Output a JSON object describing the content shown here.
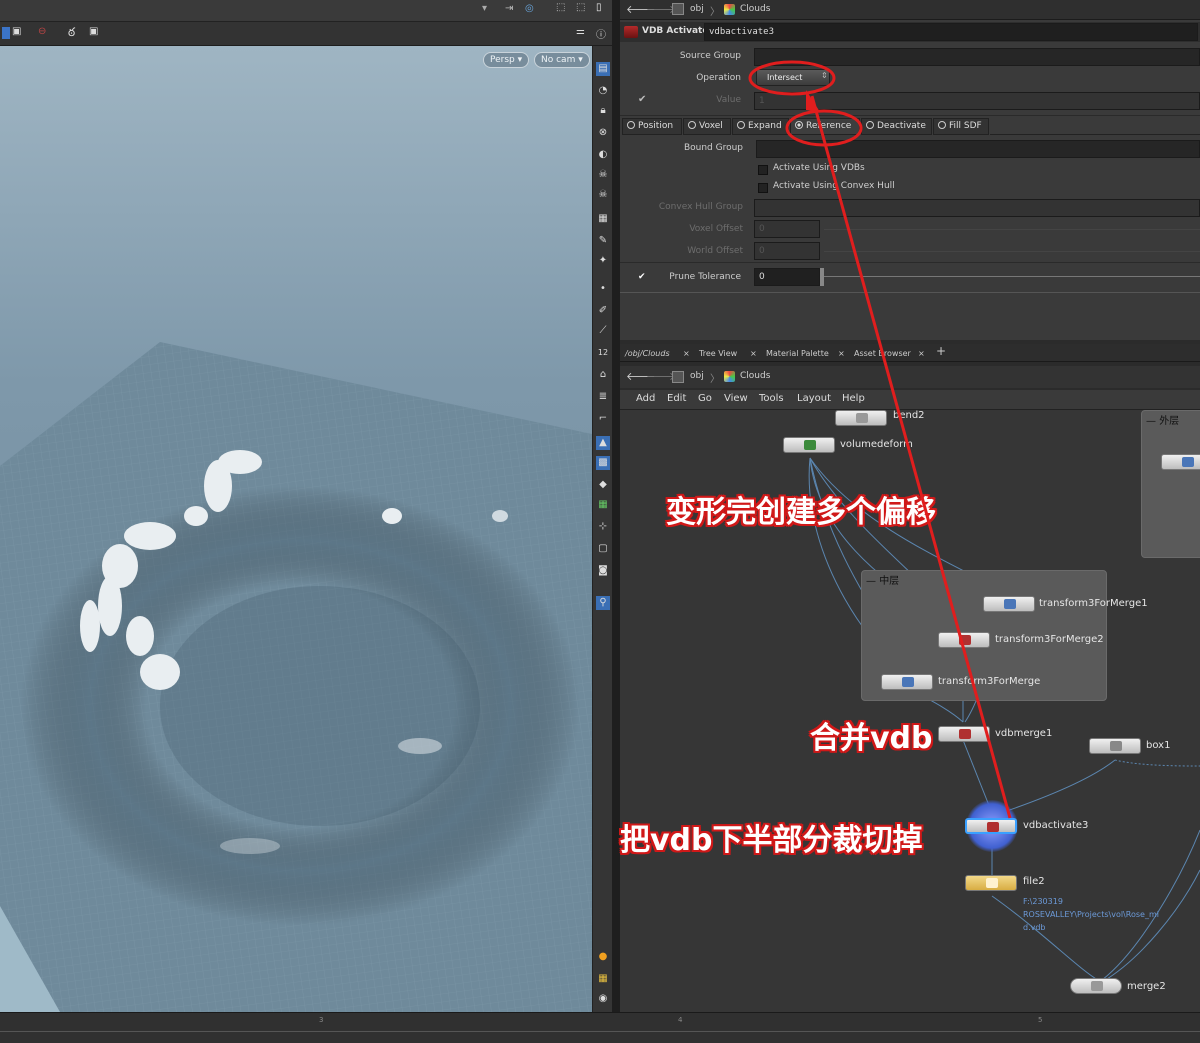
{
  "header": {
    "path_root": "obj",
    "path_node": "Clouds"
  },
  "viewport": {
    "persp_label": "Persp",
    "cam_label": "No cam"
  },
  "parameters": {
    "node_type": "VDB Activate",
    "node_name": "vdbactivate3",
    "source_group_label": "Source Group",
    "operation_label": "Operation",
    "operation_value": "Intersect",
    "value_label": "Value",
    "value_value": "1",
    "tabs": [
      "Position",
      "Voxel",
      "Expand",
      "Reference",
      "Deactivate",
      "Fill SDF"
    ],
    "bound_group_label": "Bound Group",
    "activate_vdbs_label": "Activate Using VDBs",
    "activate_hull_label": "Activate Using Convex Hull",
    "convex_hull_group_label": "Convex Hull Group",
    "voxel_offset_label": "Voxel Offset",
    "voxel_offset_value": "0",
    "world_offset_label": "World Offset",
    "world_offset_value": "0",
    "prune_tolerance_label": "Prune Tolerance",
    "prune_tolerance_value": "0"
  },
  "network": {
    "tabs": [
      "/obj/Clouds",
      "Tree View",
      "Material Palette",
      "Asset Browser"
    ],
    "path_root": "obj",
    "path_node": "Clouds",
    "menu": [
      "Add",
      "Edit",
      "Go",
      "View",
      "Tools",
      "Layout",
      "Help"
    ],
    "box_middle": "中层",
    "box_outer": "外层",
    "nodes": {
      "bend": "bend2",
      "volumedeform": "volumedeform",
      "t1": "transform3ForMerge1",
      "t2": "transform3ForMerge2",
      "t3": "transform3ForMerge",
      "merge": "vdbmerge1",
      "box": "box1",
      "activate": "vdbactivate3",
      "file": "file2",
      "file_path": "F:\\230319\nROSEVALLEY\\Projects\\vol\\Rose_mi\nd.vdb",
      "merge2": "merge2"
    }
  },
  "annotations": {
    "deform": "变形完创建多个偏移",
    "merge": "合并vdb",
    "cut": "把vdb下半部分裁切掉"
  },
  "timeline": {
    "ticks": [
      "3",
      "4",
      "5"
    ]
  }
}
